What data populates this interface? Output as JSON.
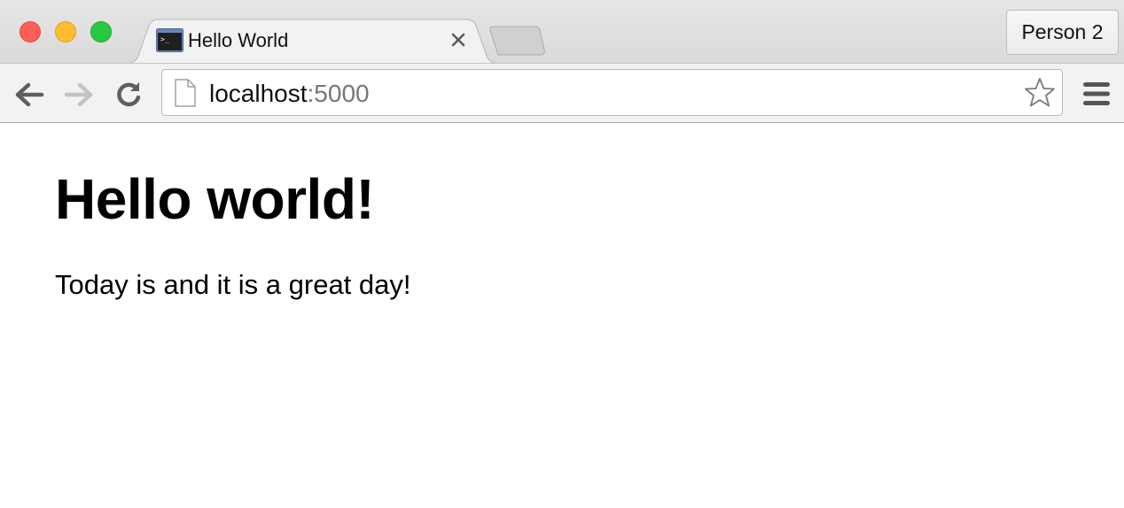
{
  "window": {
    "controls": [
      "close",
      "minimize",
      "maximize"
    ]
  },
  "tab": {
    "title": "Hello World",
    "favicon": "terminal-icon",
    "close_icon": "close-icon"
  },
  "new_tab": {
    "icon": "new-tab-icon"
  },
  "profile": {
    "label": "Person 2"
  },
  "toolbar": {
    "back_icon": "arrow-left-icon",
    "forward_icon": "arrow-right-icon",
    "reload_icon": "reload-icon",
    "menu_icon": "hamburger-menu-icon"
  },
  "address_bar": {
    "host": "localhost",
    "port": ":5000",
    "page_icon": "document-icon",
    "bookmark_icon": "star-icon"
  },
  "page": {
    "heading": "Hello world!",
    "paragraph": "Today is and it is a great day!"
  },
  "colors": {
    "traffic_close": "#fc5f57",
    "traffic_minimize": "#fdbc2e",
    "traffic_maximize": "#28c840",
    "url_port": "#767676"
  }
}
